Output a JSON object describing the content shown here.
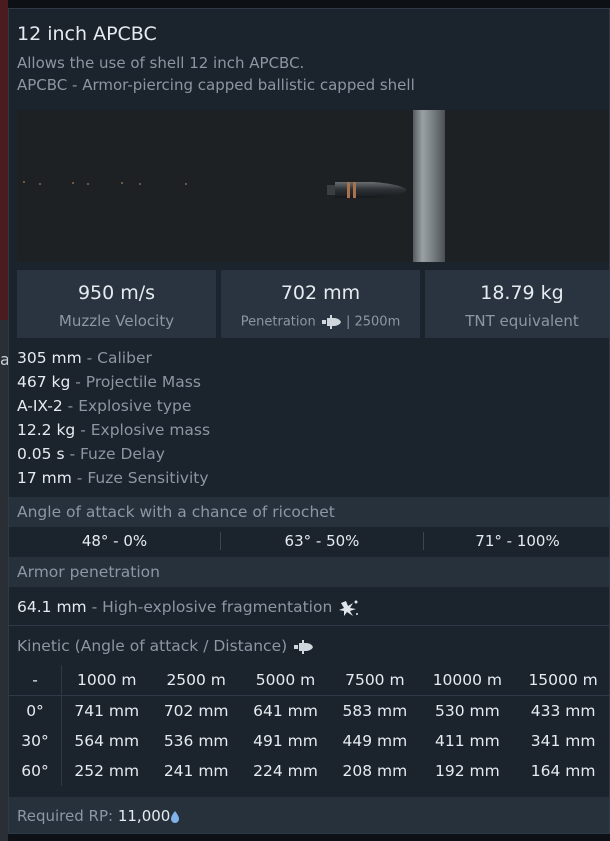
{
  "header": {
    "title": "12 inch APCBC",
    "desc_line1": "Allows the use of shell 12 inch APCBC.",
    "desc_line2": "APCBC - Armor-piercing capped ballistic capped shell"
  },
  "stats": [
    {
      "value": "950 m/s",
      "label": "Muzzle Velocity"
    },
    {
      "value": "702 mm",
      "label_prefix": "Penetration",
      "label_suffix": "| 2500m",
      "icon": "shell-icon"
    },
    {
      "value": "18.79 kg",
      "label": "TNT equivalent"
    }
  ],
  "properties": [
    {
      "value": "305 mm",
      "label": "- Caliber"
    },
    {
      "value": "467 kg",
      "label": "- Projectile Mass"
    },
    {
      "value": "A-IX-2",
      "label": "- Explosive type"
    },
    {
      "value": "12.2 kg",
      "label": "- Explosive mass"
    },
    {
      "value": "0.05 s",
      "label": "- Fuze Delay"
    },
    {
      "value": "17 mm",
      "label": "- Fuze Sensitivity"
    }
  ],
  "ricochet": {
    "title": "Angle of attack with a chance of ricochet",
    "cells": [
      "48° - 0%",
      "63° - 50%",
      "71° - 100%"
    ]
  },
  "penetration": {
    "title": "Armor penetration",
    "he_value": "64.1 mm",
    "he_label": "- High-explosive fragmentation",
    "he_icon": "explosion-icon",
    "kinetic_title": "Kinetic (Angle of attack / Distance)",
    "kinetic_icon": "shell-icon",
    "headers": [
      "-",
      "1000 m",
      "2500 m",
      "5000 m",
      "7500 m",
      "10000 m",
      "15000 m"
    ],
    "rows": [
      [
        "0°",
        "741 mm",
        "702 mm",
        "641 mm",
        "583 mm",
        "530 mm",
        "433 mm"
      ],
      [
        "30°",
        "564 mm",
        "536 mm",
        "491 mm",
        "449 mm",
        "411 mm",
        "341 mm"
      ],
      [
        "60°",
        "252 mm",
        "241 mm",
        "224 mm",
        "208 mm",
        "192 mm",
        "164 mm"
      ]
    ]
  },
  "footer": {
    "label": "Required RP:",
    "value": "11,000",
    "icon": "research-point-icon"
  },
  "background": {
    "fragment": "a"
  },
  "colors": {
    "panel": "#1b232d",
    "stat_bg": "#2a3440",
    "section_bg": "#26313c",
    "text": "#e6ebf0",
    "muted": "#8c97a3",
    "rp_icon": "#7fb2e6"
  }
}
